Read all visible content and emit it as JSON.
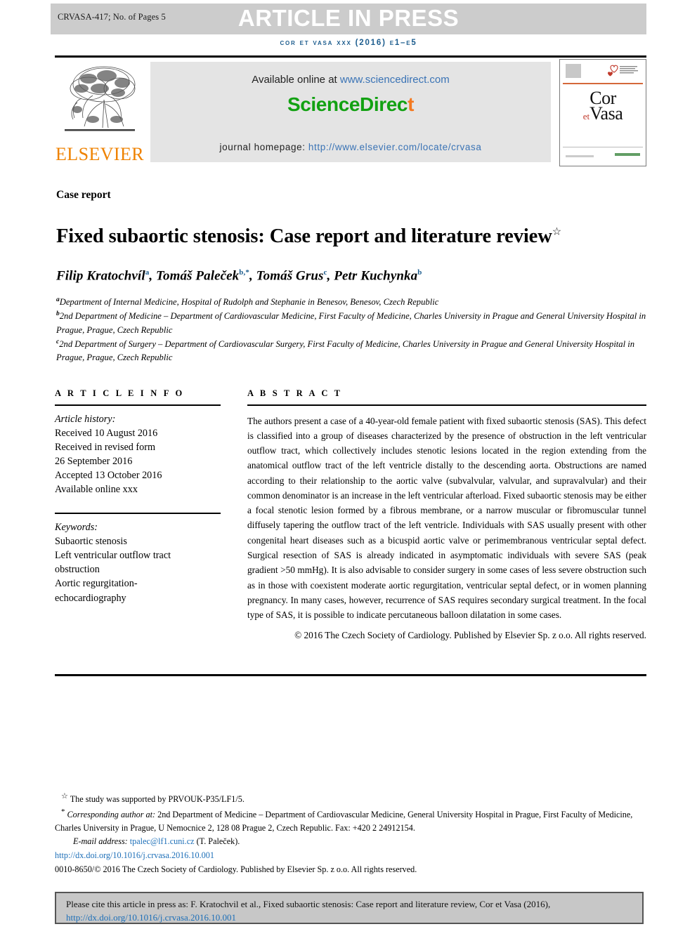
{
  "header": {
    "runhead": "CRVASA-417; No. of Pages 5",
    "press_notice": "ARTICLE IN PRESS",
    "journal_ref": "cor et vasa xxx (2016) e1–e5"
  },
  "masthead": {
    "publisher_name": "ELSEVIER",
    "publisher_logo_icon": "elsevier-tree-icon",
    "available_online_prefix": "Available online at ",
    "available_online_link": "www.sciencedirect.com",
    "sciencedirect_logo_main": "ScienceDirec",
    "sciencedirect_logo_tail": "t",
    "homepage_prefix": "journal homepage: ",
    "homepage_link": "http://www.elsevier.com/locate/crvasa",
    "cover": {
      "title_line1": "Cor",
      "title_connector": "et",
      "title_line2": "Vasa"
    }
  },
  "article": {
    "section_type": "Case report",
    "title": "Fixed subaortic stenosis: Case report and literature review",
    "title_footnote_marker": "☆",
    "authors": [
      {
        "name": "Filip Kratochvíl",
        "marks": "a"
      },
      {
        "name": "Tomáš Paleček",
        "marks": "b,*"
      },
      {
        "name": "Tomáš Grus",
        "marks": "c"
      },
      {
        "name": "Petr Kuchynka",
        "marks": "b"
      }
    ],
    "affiliations": [
      {
        "mark": "a",
        "text": "Department of Internal Medicine, Hospital of Rudolph and Stephanie in Benesov, Benesov, Czech Republic"
      },
      {
        "mark": "b",
        "text": "2nd Department of Medicine – Department of Cardiovascular Medicine, First Faculty of Medicine, Charles University in Prague and General University Hospital in Prague, Prague, Czech Republic"
      },
      {
        "mark": "c",
        "text": "2nd Department of Surgery – Department of Cardiovascular Surgery, First Faculty of Medicine, Charles University in Prague and General University Hospital in Prague, Prague, Czech Republic"
      }
    ]
  },
  "article_info": {
    "heading": "A R T I C L E  I N F O",
    "history_label": "Article history:",
    "history": [
      "Received 10 August 2016",
      "Received in revised form",
      "26 September 2016",
      "Accepted 13 October 2016",
      "Available online xxx"
    ],
    "keywords_label": "Keywords:",
    "keywords": [
      "Subaortic stenosis",
      "Left ventricular outflow tract",
      "obstruction",
      "Aortic regurgitation-",
      "echocardiography"
    ]
  },
  "abstract": {
    "heading": "A B S T R A C T",
    "text": "The authors present a case of a 40-year-old female patient with fixed subaortic stenosis (SAS). This defect is classified into a group of diseases characterized by the presence of obstruction in the left ventricular outflow tract, which collectively includes stenotic lesions located in the region extending from the anatomical outflow tract of the left ventricle distally to the descending aorta. Obstructions are named according to their relationship to the aortic valve (subvalvular, valvular, and supravalvular) and their common denominator is an increase in the left ventricular afterload. Fixed subaortic stenosis may be either a focal stenotic lesion formed by a fibrous membrane, or a narrow muscular or fibromuscular tunnel diffusely tapering the outflow tract of the left ventricle. Individuals with SAS usually present with other congenital heart diseases such as a bicuspid aortic valve or perimembranous ventricular septal defect. Surgical resection of SAS is already indicated in asymptomatic individuals with severe SAS (peak gradient >50 mmHg). It is also advisable to consider surgery in some cases of less severe obstruction such as in those with coexistent moderate aortic regurgitation, ventricular septal defect, or in women planning pregnancy. In many cases, however, recurrence of SAS requires secondary surgical treatment. In the focal type of SAS, it is possible to indicate percutaneous balloon dilatation in some cases.",
    "copyright": "© 2016 The Czech Society of Cardiology. Published by Elsevier Sp. z o.o. All rights reserved."
  },
  "footnotes": {
    "funding": "The study was supported by PRVOUK-P35/LF1/5.",
    "corresponding_label": "Corresponding author at:",
    "corresponding_text": " 2nd Department of Medicine – Department of Cardiovascular Medicine, General University Hospital in Prague, First Faculty of Medicine, Charles University in Prague, U Nemocnice 2, 128 08 Prague 2, Czech Republic. Fax: +420 2 24912154.",
    "email_label": "E-mail address:",
    "email": "tpalec@lf1.cuni.cz",
    "email_owner": "(T. Paleček).",
    "doi": "http://dx.doi.org/10.1016/j.crvasa.2016.10.001",
    "issn_line": "0010-8650/© 2016 The Czech Society of Cardiology. Published by Elsevier Sp. z o.o. All rights reserved."
  },
  "cite_box": {
    "text": "Please cite this article in press as: F. Kratochvil et al., Fixed subaortic stenosis: Case report and literature review, Cor et Vasa (2016), ",
    "link": "http://dx.doi.org/10.1016/j.crvasa.2016.10.001"
  },
  "colors": {
    "band_gray": "#cccccc",
    "journal_blue": "#1d5d8e",
    "link_blue": "#3a73b5",
    "elsevier_orange": "#ef8200",
    "sciencedirect_green": "#12a112",
    "cite_box_gray": "#c7c7c7"
  }
}
